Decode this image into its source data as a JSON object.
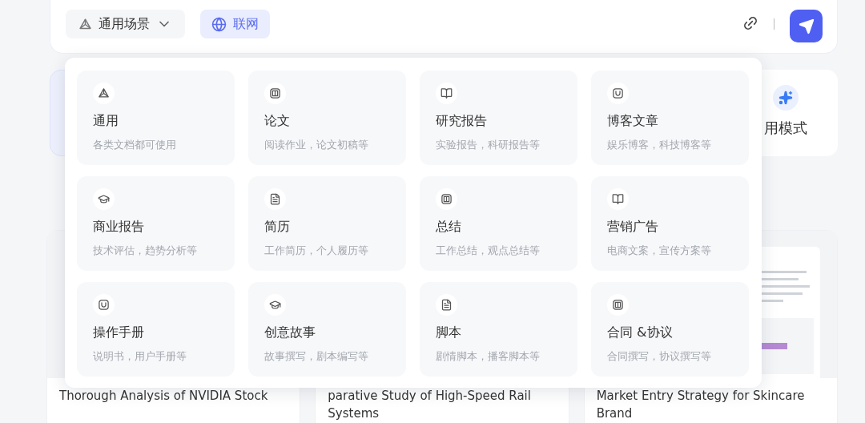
{
  "composer": {
    "scenario": {
      "label": "通用场景",
      "expanded": true
    },
    "web_search": {
      "label": "联网",
      "selected": true
    }
  },
  "mode_cards": [
    {
      "label": "用模式"
    }
  ],
  "scenario_menu": [
    {
      "title": "通用",
      "description": "各类文档都可使用"
    },
    {
      "title": "论文",
      "description": "阅读作业，论文初稿等"
    },
    {
      "title": "研究报告",
      "description": "实验报告，科研报告等"
    },
    {
      "title": "博客文章",
      "description": "娱乐博客，科技博客等"
    },
    {
      "title": "商业报告",
      "description": "技术评估，趋势分析等"
    },
    {
      "title": "简历",
      "description": "工作简历，个人履历等"
    },
    {
      "title": "总结",
      "description": "工作总结，观点总结等"
    },
    {
      "title": "营销广告",
      "description": "电商文案，宣传方案等"
    },
    {
      "title": "操作手册",
      "description": "说明书，用户手册等"
    },
    {
      "title": "创意故事",
      "description": "故事撰写，剧本编写等"
    },
    {
      "title": "脚本",
      "description": "剧情脚本，播客脚本等"
    },
    {
      "title": "合同 &协议",
      "description": "合同撰写，协议撰写等"
    }
  ],
  "examples": [
    {
      "title": "Thorough Analysis of NVIDIA Stock"
    },
    {
      "title": "parative Study of High-Speed Rail Systems"
    },
    {
      "title": "Market Entry Strategy for Skincare Brand"
    }
  ]
}
